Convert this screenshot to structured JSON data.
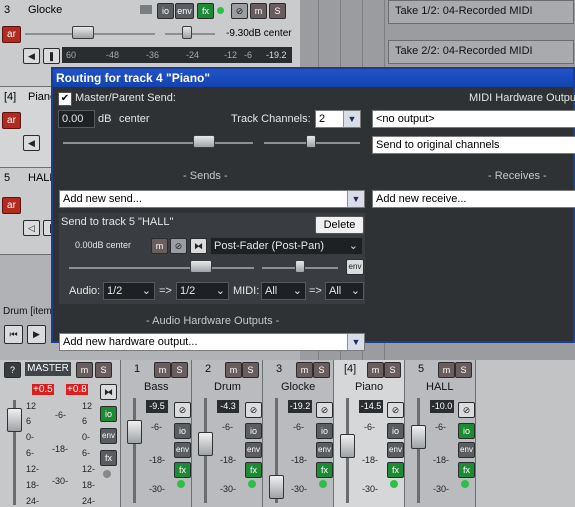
{
  "tracks": [
    {
      "num": "3",
      "name": "Glocke",
      "vol_readout": "-9.30dB center",
      "meter_scale": [
        "60",
        "-48",
        "-36",
        "-24",
        "-12",
        "-6",
        "-19.2"
      ]
    },
    {
      "num": "[4]",
      "name": "Piano"
    },
    {
      "num": "5",
      "name": "HALL"
    }
  ],
  "track_buttons": {
    "io": "io",
    "env": "env",
    "fx": "fx",
    "m": "m",
    "s": "S",
    "ar": "ar"
  },
  "arrange": {
    "item1": "Take 1/2: 04-Recorded MIDI",
    "item2": "Take 2/2: 04-Recorded MIDI",
    "drum_label": "Drum [item:"
  },
  "dialog": {
    "title": "Routing for track 4 \"Piano\"",
    "master_send": "Master/Parent Send:",
    "master_send_checked": true,
    "volume_value": "0.00",
    "volume_unit": "dB",
    "pan_value": "center",
    "track_channels_label": "Track Channels:",
    "track_channels_value": "2",
    "midi_hw_label": "MIDI Hardware Output",
    "midi_out_value": "<no output>",
    "midi_send_value": "Send to original channels",
    "sends_label": "Sends",
    "receives_label": "Receives",
    "add_send": "Add new send...",
    "add_receive": "Add new receive...",
    "send_title": "Send to track 5 \"HALL\"",
    "delete_label": "Delete",
    "send_vol": "0.00dB center",
    "send_mode": "Post-Fader (Post-Pan)",
    "audio_label": "Audio:",
    "audio_src": "1/2",
    "arrow": "=>",
    "audio_dst": "1/2",
    "midi_label": "MIDI:",
    "midi_src": "All",
    "midi_dst": "All",
    "audio_hw_label": "Audio Hardware Outputs",
    "add_hw_out": "Add new hardware output...",
    "send_btn_m": "m",
    "send_btn_env": "env"
  },
  "mixer": {
    "master_label": "MASTER",
    "master_peak_l": "+0.5",
    "master_peak_r": "+0.8",
    "master_scale": [
      "12",
      "6",
      "0-",
      "6-",
      "12-",
      "18-",
      "24-"
    ],
    "master_scale_mid": [
      "-6-",
      "-18-",
      "-30-"
    ],
    "strips": [
      {
        "num": "1",
        "name": "Bass",
        "vol": "-9.5"
      },
      {
        "num": "2",
        "name": "Drum",
        "vol": "-4.3"
      },
      {
        "num": "3",
        "name": "Glocke",
        "vol": "-19.2"
      },
      {
        "num": "[4]",
        "name": "Piano",
        "vol": "-14.5"
      },
      {
        "num": "5",
        "name": "HALL",
        "vol": "-10.0"
      }
    ],
    "strip_scale": [
      "-6-",
      "-18-",
      "-30-"
    ],
    "question": "?"
  }
}
